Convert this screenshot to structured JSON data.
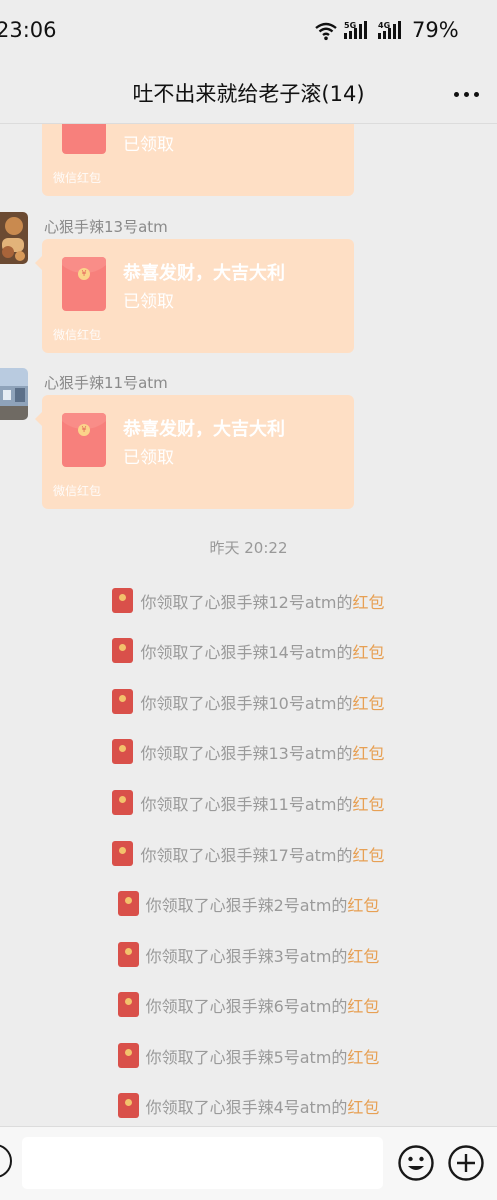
{
  "status_bar": {
    "time": "23:06",
    "net1": "5G",
    "net2": "4G",
    "battery": "79%"
  },
  "header": {
    "title": "吐不出来就给老子滚(14)",
    "more_icon": "more-dots-icon"
  },
  "messages": [
    {
      "sender": "",
      "title": "",
      "status": "已领取",
      "footer": "微信红包"
    },
    {
      "sender": "心狠手辣13号atm",
      "title": "恭喜发财，大吉大利",
      "status": "已领取",
      "footer": "微信红包"
    },
    {
      "sender": "心狠手辣11号atm",
      "title": "恭喜发财，大吉大利",
      "status": "已领取",
      "footer": "微信红包"
    }
  ],
  "timestamp": "昨天 20:22",
  "system_notices": [
    {
      "text": "你领取了心狠手辣12号atm的",
      "link": "红包"
    },
    {
      "text": "你领取了心狠手辣14号atm的",
      "link": "红包"
    },
    {
      "text": "你领取了心狠手辣10号atm的",
      "link": "红包"
    },
    {
      "text": "你领取了心狠手辣13号atm的",
      "link": "红包"
    },
    {
      "text": "你领取了心狠手辣11号atm的",
      "link": "红包"
    },
    {
      "text": "你领取了心狠手辣17号atm的",
      "link": "红包"
    },
    {
      "text": "你领取了心狠手辣2号atm的",
      "link": "红包"
    },
    {
      "text": "你领取了心狠手辣3号atm的",
      "link": "红包"
    },
    {
      "text": "你领取了心狠手辣6号atm的",
      "link": "红包"
    },
    {
      "text": "你领取了心狠手辣5号atm的",
      "link": "红包"
    },
    {
      "text": "你领取了心狠手辣4号atm的",
      "link": "红包"
    }
  ],
  "input_bar": {
    "voice_icon": "voice-icon",
    "emoji_icon": "emoji-icon",
    "plus_icon": "plus-icon",
    "value": ""
  },
  "colors": {
    "packet_bg": "#fedfc5",
    "envelope": "#f7807c",
    "link": "#e7a054",
    "page_bg": "#ededed"
  }
}
